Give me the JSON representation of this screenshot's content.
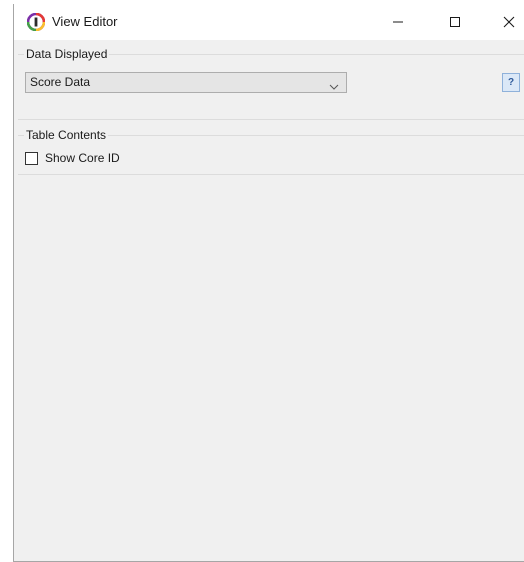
{
  "window": {
    "title": "View Editor"
  },
  "data_displayed": {
    "label": "Data Displayed",
    "selected": "Score Data",
    "help_label": "?"
  },
  "table_contents": {
    "label": "Table Contents",
    "show_core_id_label": "Show Core ID",
    "show_core_id_checked": false
  },
  "icons": {
    "app": "app-logo-icon",
    "minimize": "minimize-icon",
    "maximize": "maximize-icon",
    "close": "close-icon",
    "dropdown": "chevron-down-icon"
  },
  "colors": {
    "window_bg": "#f0f0f0",
    "titlebar_bg": "#ffffff",
    "help_accent": "#2f5a9a"
  }
}
